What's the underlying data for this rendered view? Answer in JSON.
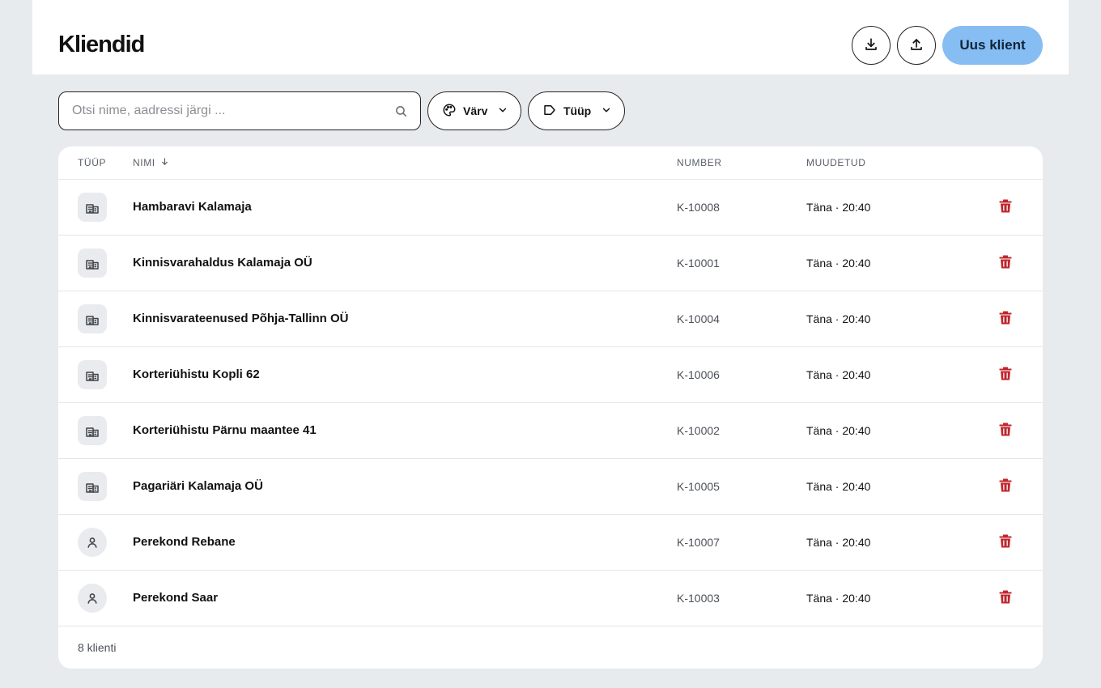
{
  "header": {
    "title": "Kliendid",
    "download_icon": "download-icon",
    "upload_icon": "upload-icon",
    "new_client_label": "Uus klient",
    "accent_color": "#86bdf3"
  },
  "filters": {
    "search_placeholder": "Otsi nime, aadressi järgi ...",
    "search_value": "",
    "color_label": "Värv",
    "type_label": "Tüüp"
  },
  "table": {
    "columns": {
      "type": "TÜÜP",
      "name": "NIMI",
      "number": "NUMBER",
      "modified": "MUUDETUD"
    },
    "sort": {
      "column": "name",
      "direction": "descending-arrow"
    },
    "rows": [
      {
        "type": "company",
        "name": "Hambaravi Kalamaja",
        "number": "K-10008",
        "modified": "Täna · 20:40"
      },
      {
        "type": "company",
        "name": "Kinnisvarahaldus Kalamaja OÜ",
        "number": "K-10001",
        "modified": "Täna · 20:40"
      },
      {
        "type": "company",
        "name": "Kinnisvarateenused Põhja-Tallinn OÜ",
        "number": "K-10004",
        "modified": "Täna · 20:40"
      },
      {
        "type": "company",
        "name": "Korteriühistu Kopli 62",
        "number": "K-10006",
        "modified": "Täna · 20:40"
      },
      {
        "type": "company",
        "name": "Korteriühistu Pärnu maantee 41",
        "number": "K-10002",
        "modified": "Täna · 20:40"
      },
      {
        "type": "company",
        "name": "Pagariäri Kalamaja OÜ",
        "number": "K-10005",
        "modified": "Täna · 20:40"
      },
      {
        "type": "person",
        "name": "Perekond Rebane",
        "number": "K-10007",
        "modified": "Täna · 20:40"
      },
      {
        "type": "person",
        "name": "Perekond Saar",
        "number": "K-10003",
        "modified": "Täna · 20:40"
      }
    ],
    "delete_color": "#c0262d",
    "footer_count": "8 klienti"
  }
}
